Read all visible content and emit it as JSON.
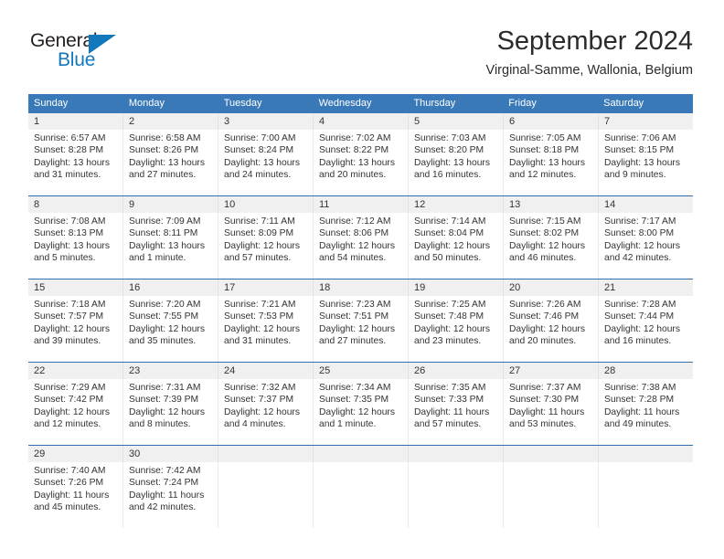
{
  "brand": {
    "name_top": "General",
    "name_bottom": "Blue",
    "triangle_icon": "triangle-icon",
    "color_top": "#231f20",
    "color_bottom": "#1278be"
  },
  "header": {
    "title": "September 2024",
    "subtitle": "Virginal-Samme, Wallonia, Belgium"
  },
  "theme": {
    "header_bar": "#3a79b8",
    "row_rule": "#2f6fae",
    "daynum_band": "#f0f0f0",
    "text": "#333333"
  },
  "weekdays": [
    "Sunday",
    "Monday",
    "Tuesday",
    "Wednesday",
    "Thursday",
    "Friday",
    "Saturday"
  ],
  "weeks": [
    [
      {
        "day": "1",
        "sunrise": "Sunrise: 6:57 AM",
        "sunset": "Sunset: 8:28 PM",
        "daylight1": "Daylight: 13 hours",
        "daylight2": "and 31 minutes."
      },
      {
        "day": "2",
        "sunrise": "Sunrise: 6:58 AM",
        "sunset": "Sunset: 8:26 PM",
        "daylight1": "Daylight: 13 hours",
        "daylight2": "and 27 minutes."
      },
      {
        "day": "3",
        "sunrise": "Sunrise: 7:00 AM",
        "sunset": "Sunset: 8:24 PM",
        "daylight1": "Daylight: 13 hours",
        "daylight2": "and 24 minutes."
      },
      {
        "day": "4",
        "sunrise": "Sunrise: 7:02 AM",
        "sunset": "Sunset: 8:22 PM",
        "daylight1": "Daylight: 13 hours",
        "daylight2": "and 20 minutes."
      },
      {
        "day": "5",
        "sunrise": "Sunrise: 7:03 AM",
        "sunset": "Sunset: 8:20 PM",
        "daylight1": "Daylight: 13 hours",
        "daylight2": "and 16 minutes."
      },
      {
        "day": "6",
        "sunrise": "Sunrise: 7:05 AM",
        "sunset": "Sunset: 8:18 PM",
        "daylight1": "Daylight: 13 hours",
        "daylight2": "and 12 minutes."
      },
      {
        "day": "7",
        "sunrise": "Sunrise: 7:06 AM",
        "sunset": "Sunset: 8:15 PM",
        "daylight1": "Daylight: 13 hours",
        "daylight2": "and 9 minutes."
      }
    ],
    [
      {
        "day": "8",
        "sunrise": "Sunrise: 7:08 AM",
        "sunset": "Sunset: 8:13 PM",
        "daylight1": "Daylight: 13 hours",
        "daylight2": "and 5 minutes."
      },
      {
        "day": "9",
        "sunrise": "Sunrise: 7:09 AM",
        "sunset": "Sunset: 8:11 PM",
        "daylight1": "Daylight: 13 hours",
        "daylight2": "and 1 minute."
      },
      {
        "day": "10",
        "sunrise": "Sunrise: 7:11 AM",
        "sunset": "Sunset: 8:09 PM",
        "daylight1": "Daylight: 12 hours",
        "daylight2": "and 57 minutes."
      },
      {
        "day": "11",
        "sunrise": "Sunrise: 7:12 AM",
        "sunset": "Sunset: 8:06 PM",
        "daylight1": "Daylight: 12 hours",
        "daylight2": "and 54 minutes."
      },
      {
        "day": "12",
        "sunrise": "Sunrise: 7:14 AM",
        "sunset": "Sunset: 8:04 PM",
        "daylight1": "Daylight: 12 hours",
        "daylight2": "and 50 minutes."
      },
      {
        "day": "13",
        "sunrise": "Sunrise: 7:15 AM",
        "sunset": "Sunset: 8:02 PM",
        "daylight1": "Daylight: 12 hours",
        "daylight2": "and 46 minutes."
      },
      {
        "day": "14",
        "sunrise": "Sunrise: 7:17 AM",
        "sunset": "Sunset: 8:00 PM",
        "daylight1": "Daylight: 12 hours",
        "daylight2": "and 42 minutes."
      }
    ],
    [
      {
        "day": "15",
        "sunrise": "Sunrise: 7:18 AM",
        "sunset": "Sunset: 7:57 PM",
        "daylight1": "Daylight: 12 hours",
        "daylight2": "and 39 minutes."
      },
      {
        "day": "16",
        "sunrise": "Sunrise: 7:20 AM",
        "sunset": "Sunset: 7:55 PM",
        "daylight1": "Daylight: 12 hours",
        "daylight2": "and 35 minutes."
      },
      {
        "day": "17",
        "sunrise": "Sunrise: 7:21 AM",
        "sunset": "Sunset: 7:53 PM",
        "daylight1": "Daylight: 12 hours",
        "daylight2": "and 31 minutes."
      },
      {
        "day": "18",
        "sunrise": "Sunrise: 7:23 AM",
        "sunset": "Sunset: 7:51 PM",
        "daylight1": "Daylight: 12 hours",
        "daylight2": "and 27 minutes."
      },
      {
        "day": "19",
        "sunrise": "Sunrise: 7:25 AM",
        "sunset": "Sunset: 7:48 PM",
        "daylight1": "Daylight: 12 hours",
        "daylight2": "and 23 minutes."
      },
      {
        "day": "20",
        "sunrise": "Sunrise: 7:26 AM",
        "sunset": "Sunset: 7:46 PM",
        "daylight1": "Daylight: 12 hours",
        "daylight2": "and 20 minutes."
      },
      {
        "day": "21",
        "sunrise": "Sunrise: 7:28 AM",
        "sunset": "Sunset: 7:44 PM",
        "daylight1": "Daylight: 12 hours",
        "daylight2": "and 16 minutes."
      }
    ],
    [
      {
        "day": "22",
        "sunrise": "Sunrise: 7:29 AM",
        "sunset": "Sunset: 7:42 PM",
        "daylight1": "Daylight: 12 hours",
        "daylight2": "and 12 minutes."
      },
      {
        "day": "23",
        "sunrise": "Sunrise: 7:31 AM",
        "sunset": "Sunset: 7:39 PM",
        "daylight1": "Daylight: 12 hours",
        "daylight2": "and 8 minutes."
      },
      {
        "day": "24",
        "sunrise": "Sunrise: 7:32 AM",
        "sunset": "Sunset: 7:37 PM",
        "daylight1": "Daylight: 12 hours",
        "daylight2": "and 4 minutes."
      },
      {
        "day": "25",
        "sunrise": "Sunrise: 7:34 AM",
        "sunset": "Sunset: 7:35 PM",
        "daylight1": "Daylight: 12 hours",
        "daylight2": "and 1 minute."
      },
      {
        "day": "26",
        "sunrise": "Sunrise: 7:35 AM",
        "sunset": "Sunset: 7:33 PM",
        "daylight1": "Daylight: 11 hours",
        "daylight2": "and 57 minutes."
      },
      {
        "day": "27",
        "sunrise": "Sunrise: 7:37 AM",
        "sunset": "Sunset: 7:30 PM",
        "daylight1": "Daylight: 11 hours",
        "daylight2": "and 53 minutes."
      },
      {
        "day": "28",
        "sunrise": "Sunrise: 7:38 AM",
        "sunset": "Sunset: 7:28 PM",
        "daylight1": "Daylight: 11 hours",
        "daylight2": "and 49 minutes."
      }
    ],
    [
      {
        "day": "29",
        "sunrise": "Sunrise: 7:40 AM",
        "sunset": "Sunset: 7:26 PM",
        "daylight1": "Daylight: 11 hours",
        "daylight2": "and 45 minutes."
      },
      {
        "day": "30",
        "sunrise": "Sunrise: 7:42 AM",
        "sunset": "Sunset: 7:24 PM",
        "daylight1": "Daylight: 11 hours",
        "daylight2": "and 42 minutes."
      },
      {
        "day": "",
        "sunrise": "",
        "sunset": "",
        "daylight1": "",
        "daylight2": ""
      },
      {
        "day": "",
        "sunrise": "",
        "sunset": "",
        "daylight1": "",
        "daylight2": ""
      },
      {
        "day": "",
        "sunrise": "",
        "sunset": "",
        "daylight1": "",
        "daylight2": ""
      },
      {
        "day": "",
        "sunrise": "",
        "sunset": "",
        "daylight1": "",
        "daylight2": ""
      },
      {
        "day": "",
        "sunrise": "",
        "sunset": "",
        "daylight1": "",
        "daylight2": ""
      }
    ]
  ]
}
